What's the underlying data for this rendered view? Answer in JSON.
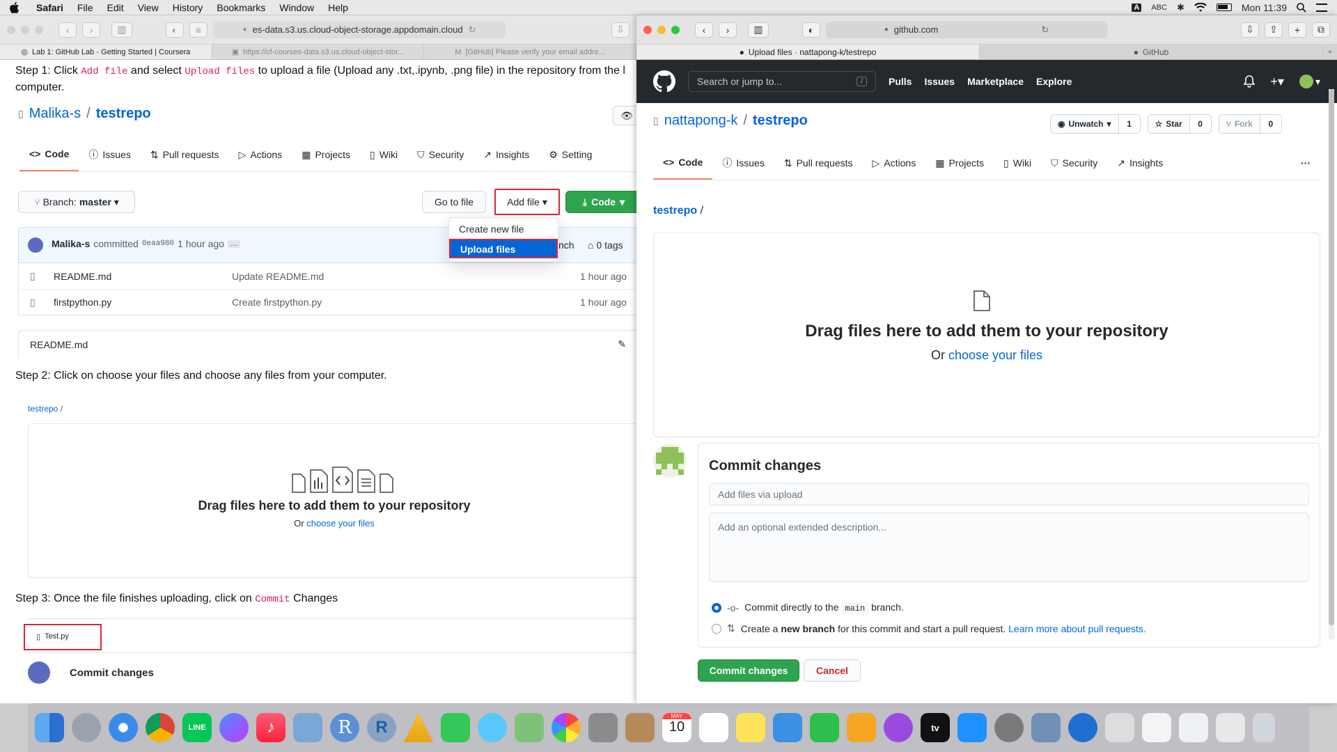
{
  "menubar": {
    "app": "Safari",
    "items": [
      "File",
      "Edit",
      "View",
      "History",
      "Bookmarks",
      "Window",
      "Help"
    ],
    "input": "ABC",
    "clock": "Mon 11:39"
  },
  "left": {
    "url": "es-data.s3.us.cloud-object-storage.appdomain.cloud",
    "tabs": [
      "Lab 1: GitHub Lab - Getting Started | Coursera",
      "https://cf-courses-data.s3.us.cloud-object-stor...",
      "[GitHub] Please verify your email addre..."
    ],
    "step1": {
      "a": "Step 1: Click ",
      "code1": "Add file",
      "b": " and select ",
      "code2": "Upload files",
      "c": " to upload a file (Upload any .txt,.ipynb, .png file) in the repository from the l",
      "d": "computer."
    },
    "owner": "Malika-s",
    "sep": "/",
    "repo": "testrepo",
    "tabs_nav": [
      "Code",
      "Issues",
      "Pull requests",
      "Actions",
      "Projects",
      "Wiki",
      "Security",
      "Insights",
      "Setting"
    ],
    "branch_label": "Branch:",
    "branch": "master",
    "goto": "Go to file",
    "addfile": "Add file",
    "code_btn": "Code",
    "menu": [
      "Create new file",
      "Upload files"
    ],
    "commit": {
      "user": "Malika-s",
      "verb": "committed",
      "sha": "0eaa980",
      "time": "1 hour ago",
      "more": "…",
      "branch_frag": "nch",
      "tags": "0 tags"
    },
    "files": [
      {
        "name": "README.md",
        "msg": "Update README.md",
        "time": "1 hour ago"
      },
      {
        "name": "firstpython.py",
        "msg": "Create firstpython.py",
        "time": "1 hour ago"
      }
    ],
    "readme": "README.md",
    "step2": "Step 2: Click on choose your files and choose any files from your computer.",
    "mini_repo": "testrepo",
    "mini_sep": "/",
    "drag": "Drag files here to add them to your repository",
    "or": "Or",
    "choose": "choose your files",
    "step3a": "Step 3: Once the file finishes uploading, click on ",
    "step3code": "Commit",
    "step3b": " Changes",
    "testfile": "Test.py",
    "commit_changes": "Commit changes"
  },
  "right": {
    "url": "github.com",
    "tabs": [
      "Upload files · nattapong-k/testrepo",
      "GitHub"
    ],
    "search": "Search or jump to...",
    "slash": "/",
    "nav": [
      "Pulls",
      "Issues",
      "Marketplace",
      "Explore"
    ],
    "owner": "nattapong-k",
    "sep": "/",
    "repo": "testrepo",
    "unwatch": "Unwatch",
    "watch_count": "1",
    "star": "Star",
    "star_count": "0",
    "fork": "Fork",
    "fork_count": "0",
    "tabs_nav": [
      "Code",
      "Issues",
      "Pull requests",
      "Actions",
      "Projects",
      "Wiki",
      "Security",
      "Insights"
    ],
    "more": "···",
    "breadcrumb": "testrepo",
    "breadcrumb_sep": "/",
    "drag": "Drag files here to add them to your repository",
    "or": "Or",
    "choose": "choose your files",
    "commit_title": "Commit changes",
    "summary_ph": "Add files via upload",
    "desc_ph": "Add an optional extended description...",
    "opt1a": "Commit directly to the ",
    "opt1code": "main",
    "opt1b": " branch.",
    "opt2a": "Create a ",
    "opt2b": "new branch",
    "opt2c": " for this commit and start a pull request. ",
    "opt2link": "Learn more about pull requests.",
    "commit_btn": "Commit changes",
    "cancel": "Cancel"
  },
  "dock": {
    "calendar_month": "MAY",
    "calendar_day": "10",
    "appletv": "tv"
  }
}
